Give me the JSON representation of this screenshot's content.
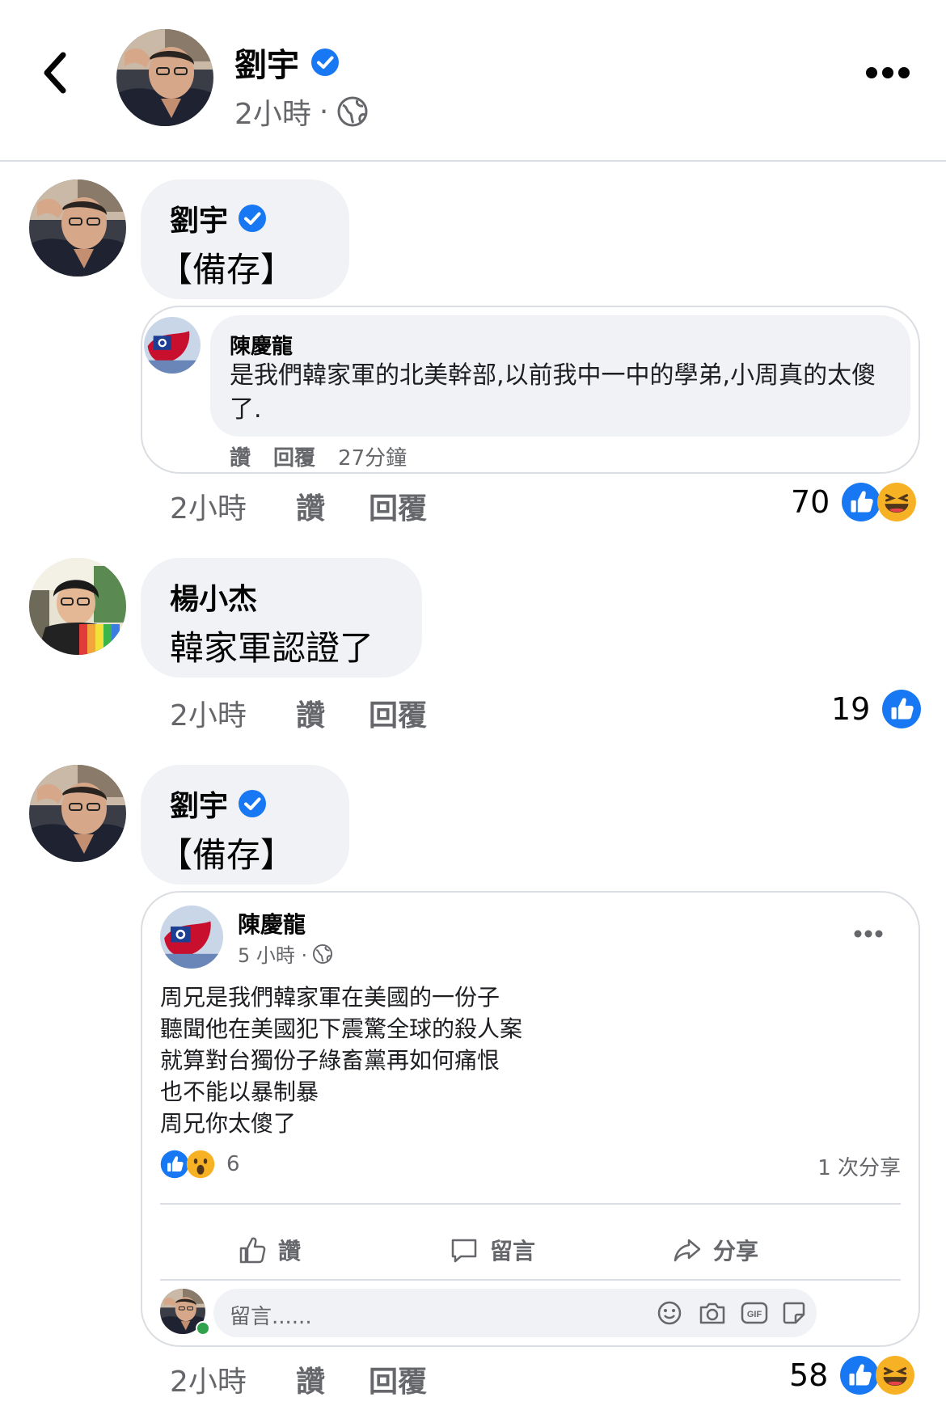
{
  "header": {
    "name": "劉宇",
    "time": "2小時",
    "dot": "·"
  },
  "comments": [
    {
      "author": "劉宇",
      "text": "【備存】",
      "time": "2小時",
      "like": "讚",
      "reply": "回覆",
      "count": "70",
      "embedded": {
        "author": "陳慶龍",
        "text": "是我們韓家軍的北美幹部,以前我中一中的學弟,小周真的太傻了.",
        "like": "讚",
        "reply": "回覆",
        "time": "27分鐘"
      }
    },
    {
      "author": "楊小杰",
      "text": "韓家軍認證了",
      "time": "2小時",
      "like": "讚",
      "reply": "回覆",
      "count": "19"
    },
    {
      "author": "劉宇",
      "text": "【備存】",
      "time": "2小時",
      "like": "讚",
      "reply": "回覆",
      "count": "58",
      "embedded_post": {
        "author": "陳慶龍",
        "time": "5 小時 ·",
        "lines": [
          "周兄是我們韓家軍在美國的一份子",
          "聽聞他在美國犯下震驚全球的殺人案",
          "就算對台獨份子綠畜黨再如何痛恨",
          "也不能以暴制暴",
          "周兄你太傻了"
        ],
        "reaction_count": "6",
        "shares": "1 次分享",
        "like_label": "讚",
        "comment_label": "留言",
        "share_label": "分享",
        "comment_placeholder": "留言......"
      }
    }
  ],
  "colors": {
    "blue": "#1877f2",
    "gray_text": "#65676b",
    "bubble": "#f0f2f5",
    "divider": "#dadde1"
  }
}
